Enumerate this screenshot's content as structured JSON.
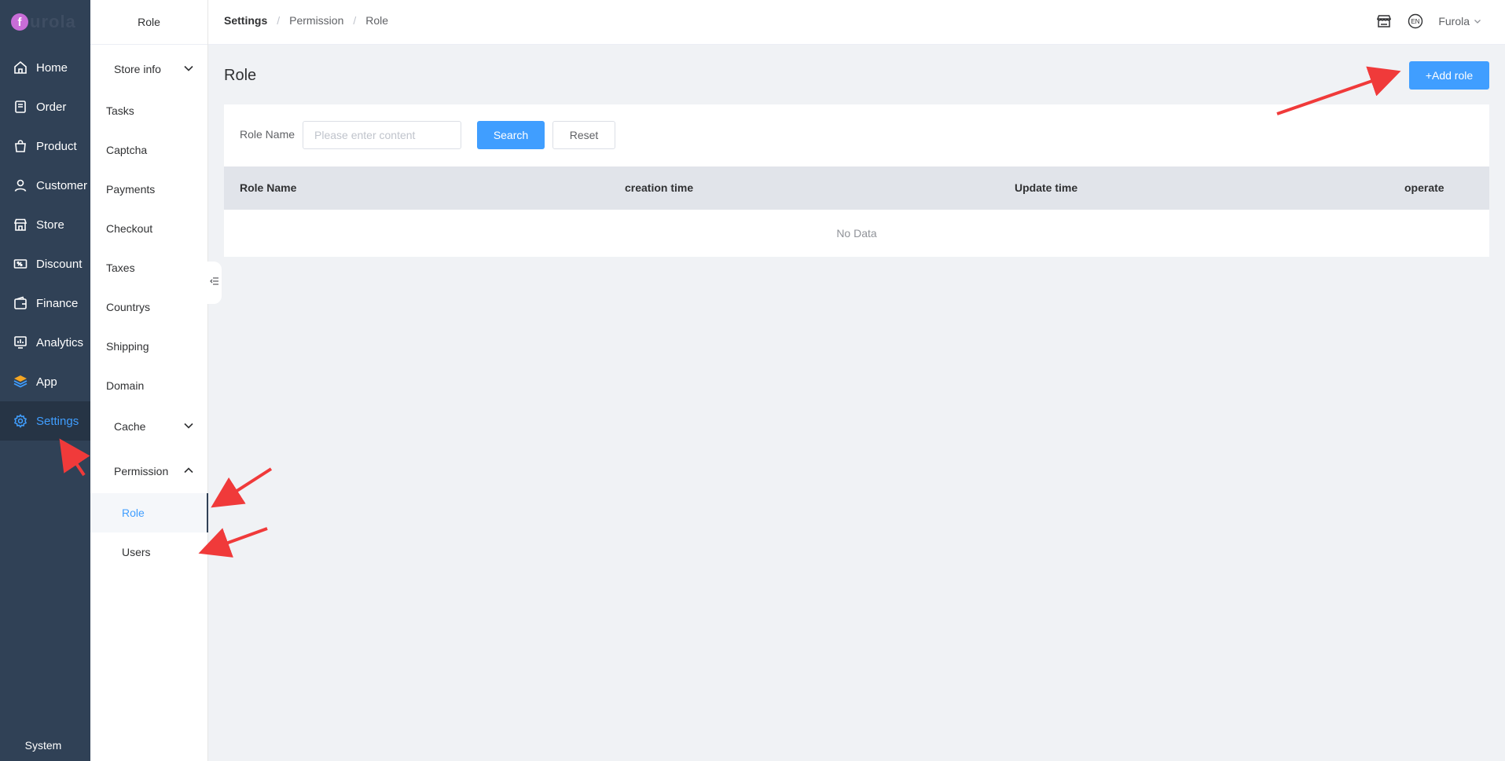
{
  "logo": {
    "mark": "f",
    "text": "urola"
  },
  "nav": {
    "items": [
      {
        "label": "Home",
        "icon": "home-icon"
      },
      {
        "label": "Order",
        "icon": "order-icon"
      },
      {
        "label": "Product",
        "icon": "bag-icon"
      },
      {
        "label": "Customer",
        "icon": "user-icon"
      },
      {
        "label": "Store",
        "icon": "store-icon"
      },
      {
        "label": "Discount",
        "icon": "discount-icon"
      },
      {
        "label": "Finance",
        "icon": "wallet-icon"
      },
      {
        "label": "Analytics",
        "icon": "chart-icon"
      },
      {
        "label": "App",
        "icon": "cube-icon"
      },
      {
        "label": "Settings",
        "icon": "gear-icon",
        "active": true
      }
    ],
    "system_label": "System"
  },
  "subnav": {
    "title": "Role",
    "store_info": "Store info",
    "tasks": "Tasks",
    "captcha": "Captcha",
    "payments": "Payments",
    "checkout": "Checkout",
    "taxes": "Taxes",
    "countrys": "Countrys",
    "shipping": "Shipping",
    "domain": "Domain",
    "cache": "Cache",
    "permission": "Permission",
    "role": "Role",
    "users": "Users"
  },
  "header": {
    "breadcrumb": {
      "first": "Settings",
      "second": "Permission",
      "third": "Role"
    },
    "lang_badge": "EN",
    "user_name": "Furola"
  },
  "main": {
    "title": "Role",
    "add_button": "+Add role",
    "filter": {
      "label": "Role Name",
      "placeholder": "Please enter content",
      "value": "",
      "search_button": "Search",
      "reset_button": "Reset"
    },
    "table": {
      "columns": [
        "Role Name",
        "creation time",
        "Update time",
        "operate"
      ],
      "empty_text": "No Data"
    }
  },
  "colors": {
    "accent": "#409eff",
    "nav_bg": "#304156",
    "arrow": "#f03a3a"
  }
}
